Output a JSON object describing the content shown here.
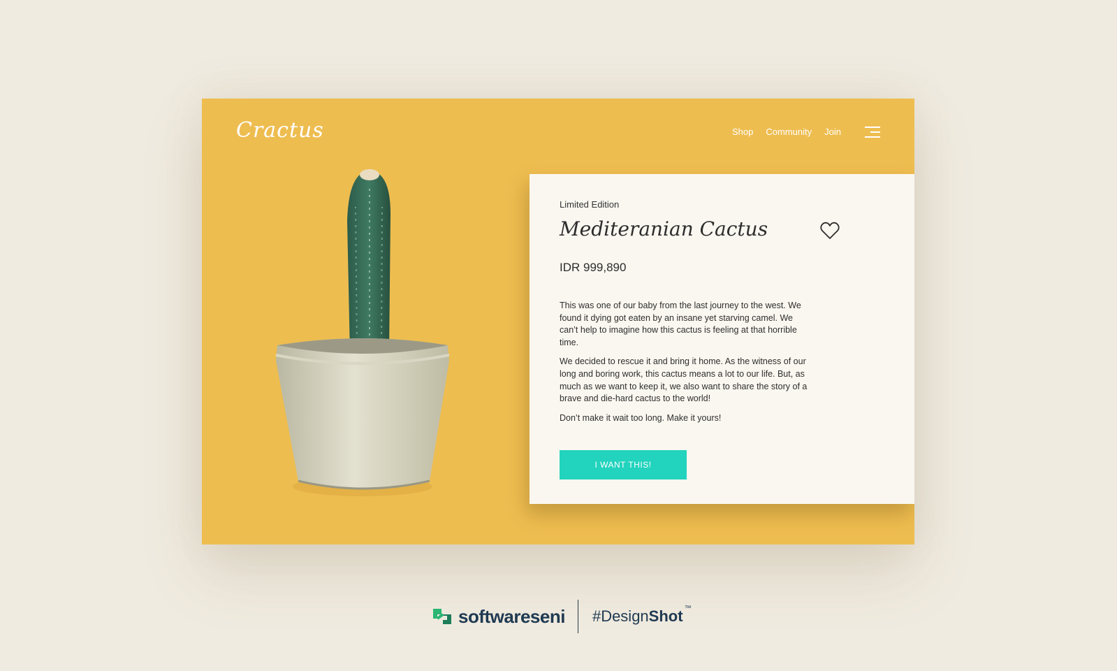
{
  "app": {
    "logo": "Cractus"
  },
  "nav": {
    "items": [
      "Shop",
      "Community",
      "Join"
    ],
    "menu_icon": "hamburger-menu-icon"
  },
  "product": {
    "eyebrow": "Limited Edition",
    "title": "Mediteranian Cactus",
    "price": "IDR 999,890",
    "favorite_icon": "heart-outline-icon",
    "description": [
      "This was one of our baby from the last journey to the west. We found it dying got eaten by an insane yet starving camel. We can’t help to imagine how this cactus is feeling at that horrible time.",
      "We decided to rescue it and bring it home. As the witness of our long and boring work, this cactus means a lot to our life. But, as much as we want to keep it, we also want to share the story of a brave and die-hard cactus to the world!",
      "Don’t make it wait too long. Make it yours!"
    ],
    "cta_label": "I WANT THIS!"
  },
  "footer": {
    "brand": "softwareseni",
    "hashtag_prefix": "#Design",
    "hashtag_bold": "Shot",
    "trademark": "™"
  },
  "colors": {
    "background": "#f0ebe0",
    "canvas": "#eebd50",
    "card": "#faf7f0",
    "accent": "#22d3bd",
    "brand_dark": "#1f3a52",
    "brand_green": "#2bb673"
  }
}
